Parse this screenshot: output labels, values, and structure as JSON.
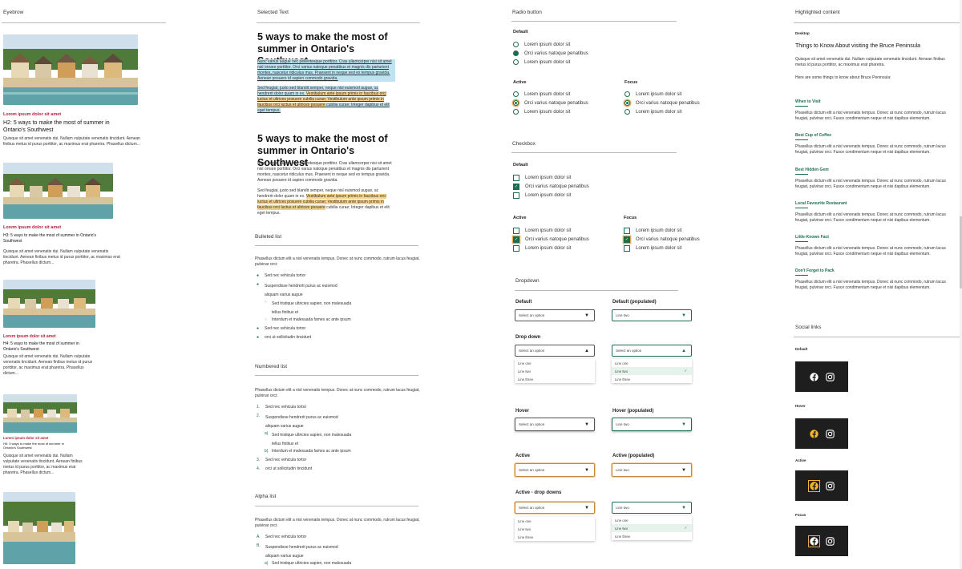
{
  "col1": {
    "title": "Eyebrow",
    "cards": [
      {
        "eyebrow": "Lorem ipsum dolor sit amet",
        "heading": "H2: 5 ways to make the most of summer in Ontario's Southwest",
        "body": "Quisque sit amet venenatis dui. Nullam vulputate venenatis tincidunt. Aenean finibus metus id purus porttitor, ac maximus erat pharetra. Phasellus dictum..."
      },
      {
        "eyebrow": "Lorem ipsum dolor sit amet",
        "heading": "H3: 5 ways to make the most of summer in Ontario's Southwest",
        "body": "Quisque sit amet venenatis dui. Nullam vulputate venenatis tincidunt. Aenean finibus metus id purus porttitor, ac maximus erat pharetra. Phasellus dictum..."
      },
      {
        "eyebrow": "Lorem ipsum dolor sit amet",
        "heading": "H4: 5 ways to make the most of summer in Ontario's Southwest",
        "body": "Quisque sit amet venenatis dui. Nullam vulputate venenatis tincidunt. Aenean finibus metus id purus porttitor, ac maximus erat pharetra. Phasellus dictum..."
      },
      {
        "eyebrow": "Lorem ipsum dolor sit amet",
        "heading": "H5: 5 ways to make the most of summer in Ontario's Southwest",
        "body": "Quisque sit amet venenatis dui. Nullam vulputate venenatis tincidunt. Aenean finibus metus id purus porttitor, ac maximus erat pharetra. Phasellus dictum..."
      }
    ]
  },
  "col2": {
    "title": "Selected Text",
    "heading1": "5 ways to make the most of summer in Ontario's Southwest",
    "sel_para1": "Nunc varius augue nec pellentesque porttitor. Cras ullamcorper nisi sit amet nisl ornare porttitor. Orci varius natoque penatibus et magnis dis parturient montes, nascetur ridiculus mus. Praesent in neque sed ex tempus gravida. Aenean posuere id sapien commodo gravida.",
    "sel_para2_a": "Sed feugiat, justo sed blandit semper, neque nisl euismod augue, ac hendrerit dolor quam in ex. ",
    "sel_para2_b": "Vestibulum ante ipsum primis in faucibus orci luctus et ultrices posuere cubilia curae; Vestibulum ante ipsum primis in faucibus orci luctus et ultrices posuere",
    "sel_para2_c": " cubilia curae; Integer dapibus et elit eget tempus.",
    "heading2": "5 ways to make the most of summer in Ontario's Southwest",
    "para1": "Nunc varius augue nec pellentesque porttitor. Cras ullamcorper nisi sit amet nisl ornare porttitor. Orci varius natoque penatibus et magnis dis parturient montes, nascetur ridiculus mus. Praesent in neque sed ex tempus gravida. Aenean posuere id sapien commodo gravida.",
    "para2_a": "Sed feugiat, justo sed blandit semper, neque nisl euismod augue, ac hendrerit dolor quam in ex. ",
    "para2_b": "Vestibulum ante ipsum primis in faucibus orci luctus et ultrices posuere cubilia curae; Vestibulum ante ipsum primis in faucibus orci luctus et ultrices posuere",
    "para2_c": " cubilia curae; Integer dapibus et elit eget tempus.",
    "bulleted": {
      "title": "Bulleted list",
      "intro": "Phasellus dictum elit a nisl venenatis tempus. Donec at nunc commodo, rutrum lacus feugiat, pulvinar orci:",
      "items": [
        "Sed nec vehicula tortor",
        "Suspendisse hendrerit purus ac euismod aliquam varius augue",
        "Sed tristique ultricies sapien, non malesuada tellus finibus et",
        "Interdum et malesuada fames ac ante ipsum",
        "Sed nec vehicula tortor",
        "orci ut sollicitudin tincidunt"
      ]
    },
    "numbered": {
      "title": "Numbered list",
      "intro": "Phasellus dictum elit a nisl venenatis tempus. Donec at nunc commodo, rutrum lacus feugiat, pulvinar orci:",
      "markers": [
        "1.",
        "2.",
        "a)",
        "b)",
        "3.",
        "4."
      ],
      "items": [
        "Sed nec vehicula tortor",
        "Suspendisse hendrerit purus ac euismod aliquam varius augue",
        "Sed tristique ultricies sapien, non malesuada tellus finibus et",
        "Interdum et malesuada fames ac ante ipsum",
        "Sed nec vehicula tortor",
        "orci ut sollicitudin tincidunt"
      ]
    },
    "alpha": {
      "title": "Alpha list",
      "intro": "Phasellus dictum elit a nisl venenatis tempus. Donec at nunc commodo, rutrum lacus feugiat, pulvinar orci:",
      "markers": [
        "A.",
        "B.",
        "a)"
      ],
      "items": [
        "Sed nec vehicula tortor",
        "Suspendisse hendrerit purus ac euismod aliquam varius augue",
        "Sed tristique ultricies sapien, non malesuada"
      ]
    }
  },
  "col3": {
    "radio": {
      "title": "Radio button",
      "default": "Default",
      "active": "Active",
      "focus": "Focus",
      "items": [
        "Lorem ipsum dolor sit",
        "Orci varius natoque penatibus",
        "Lorem ipsum dolor sit"
      ]
    },
    "checkbox": {
      "title": "Checkbox",
      "default": "Default",
      "active": "Active",
      "focus": "Focus",
      "items": [
        "Lorem ipsum dolor sit",
        "Orci varius natoque penatibus",
        "Lorem ipsum dolor sit"
      ]
    },
    "dropdown": {
      "title": "Dropdown",
      "default": "Default",
      "default_pop": "Default (populated)",
      "dropdown": "Drop down",
      "hover": "Hover",
      "hover_pop": "Hover (populated)",
      "active": "Active",
      "active_pop": "Active (populated)",
      "active_dd": "Active - drop downs",
      "placeholder": "Select an option",
      "selected": "Line two",
      "options": [
        "Line one",
        "Line two",
        "Line three"
      ]
    }
  },
  "col4": {
    "title": "Highlighted content",
    "desktop": "Desktop",
    "heading": "Things to Know About visiting the Bruce Peninsula",
    "intro": "Quisque sit amet venenatis dui. Nullam vulputate venenatis tincidunt. Aenean finibus metus id purus porttitor, ac maximus erat pharetra.",
    "intro2": "Here are some things to know about Bruce Peninsula:",
    "items": [
      {
        "title": "When to Visit",
        "body": "Phasellus dictum elit a nisl venenatis tempus. Donec at nunc commodo, rutrum lacus feugiat, pulvinar orci. Fusce condimentum neque et nisi dapibus elementum."
      },
      {
        "title": "Best Cup of Coffee",
        "body": "Phasellus dictum elit a nisl venenatis tempus. Donec at nunc commodo, rutrum lacus feugiat, pulvinar orci. Fusce condimentum neque et nisi dapibus elementum."
      },
      {
        "title": "Best Hidden Gem",
        "body": "Phasellus dictum elit a nisl venenatis tempus. Donec at nunc commodo, rutrum lacus feugiat, pulvinar orci. Fusce condimentum neque et nisi dapibus elementum."
      },
      {
        "title": "Local Favourite Restaurant",
        "body": "Phasellus dictum elit a nisl venenatis tempus. Donec at nunc commodo, rutrum lacus feugiat, pulvinar orci. Fusce condimentum neque et nisi dapibus elementum."
      },
      {
        "title": "Little-Known Fact",
        "body": "Phasellus dictum elit a nisl venenatis tempus. Donec at nunc commodo, rutrum lacus feugiat, pulvinar orci. Fusce condimentum neque et nisi dapibus elementum."
      },
      {
        "title": "Don't Forget to Pack",
        "body": "Phasellus dictum elit a nisl venenatis tempus. Donec at nunc commodo, rutrum lacus feugiat, pulvinar orci. Fusce condimentum neque et nisi dapibus elementum."
      }
    ],
    "social": {
      "title": "Social links",
      "states": [
        "Default",
        "Hover",
        "Active",
        "Focus"
      ],
      "icons": [
        "facebook-icon",
        "instagram-icon"
      ]
    }
  },
  "colors": {
    "accent_green": "#1a6e4f",
    "eyebrow_red": "#b01e3c",
    "highlight_yellow": "#f8d28a",
    "focus_orange": "#e3a85a",
    "hover_gold": "#f2b632"
  }
}
